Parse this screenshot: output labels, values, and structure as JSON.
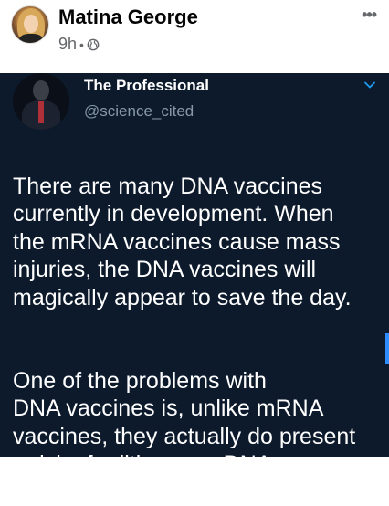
{
  "post": {
    "author": "Matina George",
    "time": "9h",
    "separator": "•"
  },
  "tweet": {
    "name": "The Professional",
    "handle": "@science_cited",
    "paragraphs": [
      "There are many DNA vaccines\ncurrently in development. When\nthe mRNA vaccines cause mass\ninjuries, the DNA vaccines will\nmagically appear to save the day.",
      "One of the problems with\nDNA vaccines is, unlike mRNA\nvaccines, they actually do present\na risk of editing your DNA."
    ]
  },
  "icons": {
    "more": "more-options-icon",
    "privacy": "globe-icon",
    "chevron": "chevron-down-icon"
  },
  "colors": {
    "tweet_background": "#0c1a2c",
    "handle": "#8899a6",
    "chevron": "#1d9bf0"
  }
}
